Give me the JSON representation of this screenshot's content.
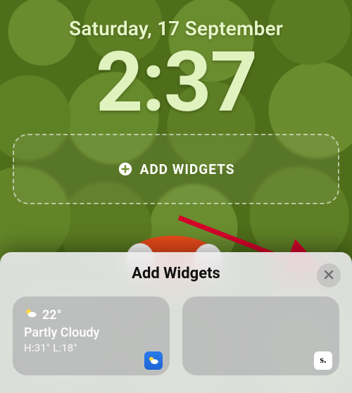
{
  "lockscreen": {
    "date": "Saturday, 17 September",
    "time": "2:37",
    "add_widgets_label": "ADD WIDGETS"
  },
  "sheet": {
    "title": "Add Widgets",
    "close_icon": "close-icon",
    "cards": {
      "weather": {
        "icon": "partly-cloudy-icon",
        "temp": "22°",
        "condition": "Partly Cloudy",
        "hilo": "H:31° L:18°",
        "badge": "weather-app-icon"
      },
      "second": {
        "badge_letter": "s."
      }
    }
  },
  "annotation": {
    "arrow_color": "#d4002a"
  }
}
